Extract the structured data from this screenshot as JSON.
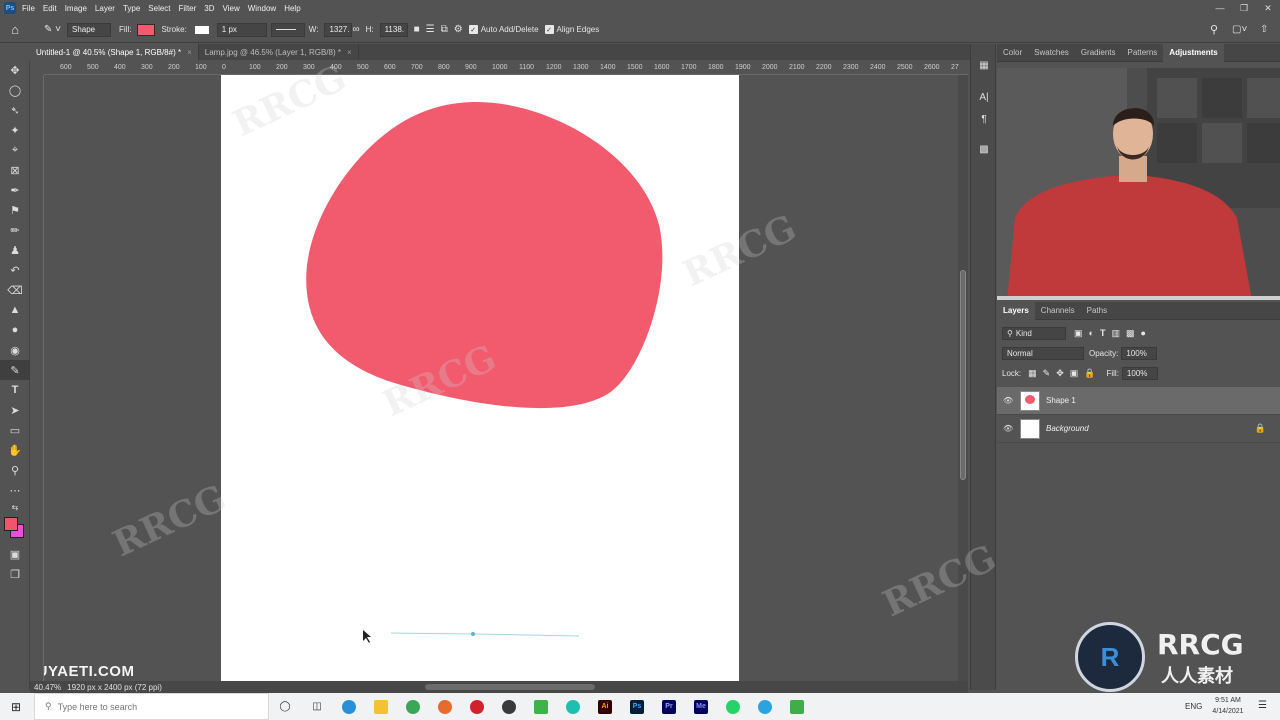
{
  "menubar": {
    "app_logo": "Ps",
    "items": [
      "File",
      "Edit",
      "Image",
      "Layer",
      "Type",
      "Select",
      "Filter",
      "3D",
      "View",
      "Window",
      "Help"
    ]
  },
  "options": {
    "mode": "Shape",
    "fill_label": "Fill:",
    "fill_color": "#f25a6e",
    "stroke_label": "Stroke:",
    "stroke_width": "1 px",
    "w_label": "W:",
    "w_value": "1327.",
    "h_label": "H:",
    "h_value": "1138.",
    "auto_add_delete": "Auto Add/Delete",
    "align_edges": "Align Edges"
  },
  "tabs": [
    {
      "label": "Untitled-1 @ 40.5% (Shape 1, RGB/8#) *",
      "close": "×"
    },
    {
      "label": "Lamp.jpg @ 46.5% (Layer 1, RGB/8) *",
      "close": "×"
    }
  ],
  "ruler_h": [
    "600",
    "500",
    "400",
    "300",
    "200",
    "100",
    "0",
    "100",
    "200",
    "300",
    "400",
    "500",
    "600",
    "700",
    "800",
    "900",
    "1000",
    "1100",
    "1200",
    "1300",
    "1400",
    "1500",
    "1600",
    "1700",
    "1800",
    "1900",
    "2000",
    "2100",
    "2200",
    "2300",
    "2400",
    "2500",
    "2600",
    "27"
  ],
  "status": {
    "zoom": "40.47%",
    "doc_info": "1920 px x 2400 px (72 ppi)"
  },
  "watermark_site": "POUYAETI.COM",
  "right_panel": {
    "tabs": [
      "Color",
      "Swatches",
      "Gradients",
      "Patterns",
      "Adjustments"
    ],
    "active_tab": "Adjustments"
  },
  "layers_panel": {
    "tabs": [
      "Layers",
      "Channels",
      "Paths"
    ],
    "filter_kind": "Kind",
    "blend_mode": "Normal",
    "opacity_label": "Opacity:",
    "opacity_value": "100%",
    "lock_label": "Lock:",
    "fill_label": "Fill:",
    "fill_value": "100%",
    "layers": [
      {
        "name": "Shape 1",
        "selected": true
      },
      {
        "name": "Background",
        "selected": false
      }
    ]
  },
  "brand_logo": {
    "text": "RRCG",
    "subtext": "人人素材"
  },
  "taskbar": {
    "search_placeholder": "Type here to search",
    "lang": "ENG",
    "time": "9:51 AM",
    "date": "4/14/2021"
  },
  "colors": {
    "shape_fill": "#f25a6e",
    "foreground": "#f0556b",
    "background_swatch": "#e84fdc"
  }
}
